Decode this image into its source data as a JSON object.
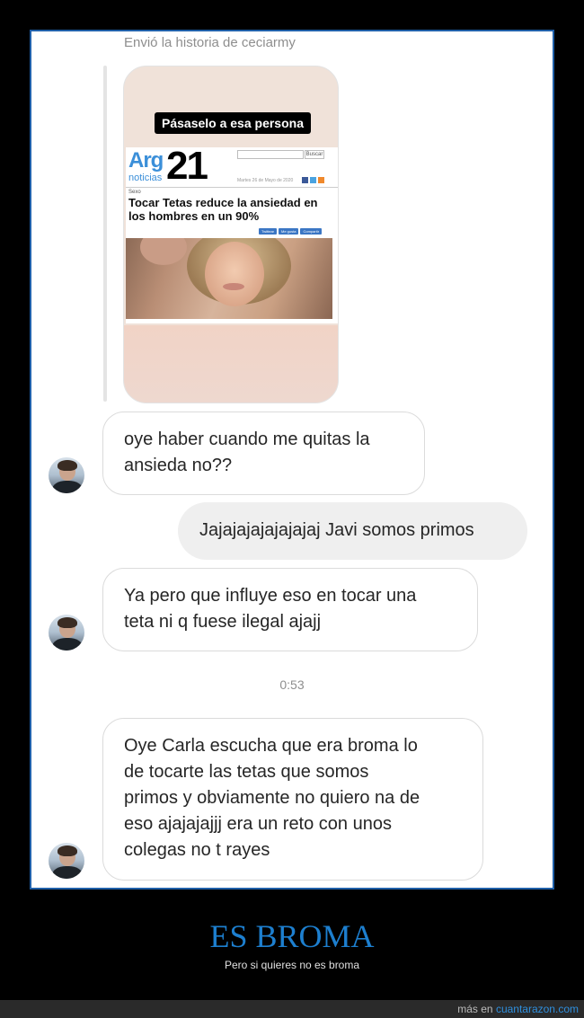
{
  "conversation": {
    "story_caption": "Envió la historia de ceciarmy",
    "story": {
      "share_sticker": "Pásaselo a esa persona",
      "article": {
        "logo_arg": "Arg",
        "logo_noticias": "noticias",
        "logo_number": "21",
        "search_button": "Buscar",
        "date": "Martes 26 de Mayo de 2020",
        "section": "Sexo",
        "headline": "Tocar Tetas reduce la ansiedad en los hombres en un 90%",
        "share_buttons": [
          "Twittear",
          "Me gusta",
          "Compartir"
        ]
      }
    },
    "messages": [
      {
        "id": "m1",
        "side": "received",
        "lines": [
          "oye haber cuando me quitas la",
          "ansieda no??"
        ]
      },
      {
        "id": "m2",
        "side": "sent",
        "lines": [
          "Jajajajajajajajaj Javi somos primos"
        ]
      },
      {
        "id": "m3",
        "side": "received",
        "lines": [
          "Ya pero que influye eso en tocar una",
          "teta ni q fuese ilegal ajajj"
        ]
      },
      {
        "id": "m4",
        "side": "received",
        "lines": [
          "Oye Carla escucha que era broma lo",
          "de tocarte las tetas que somos",
          "primos y obviamente no quiero na de",
          "eso ajajajajjj era un reto con unos",
          "colegas no t rayes"
        ]
      }
    ],
    "timestamp": "0:53"
  },
  "meme": {
    "title": "ES BROMA",
    "subtitle": "Pero si quieres no es broma"
  },
  "footer": {
    "prefix": "más en",
    "link": "cuantarazon.com"
  },
  "colors": {
    "frame_border": "#1f5fa8",
    "title": "#1d7fcf",
    "logo_blue": "#3b8fd9",
    "sent_bubble": "#efefef",
    "received_border": "#dbdbdb"
  },
  "icons": [
    "facebook-icon",
    "twitter-icon",
    "rss-icon"
  ]
}
